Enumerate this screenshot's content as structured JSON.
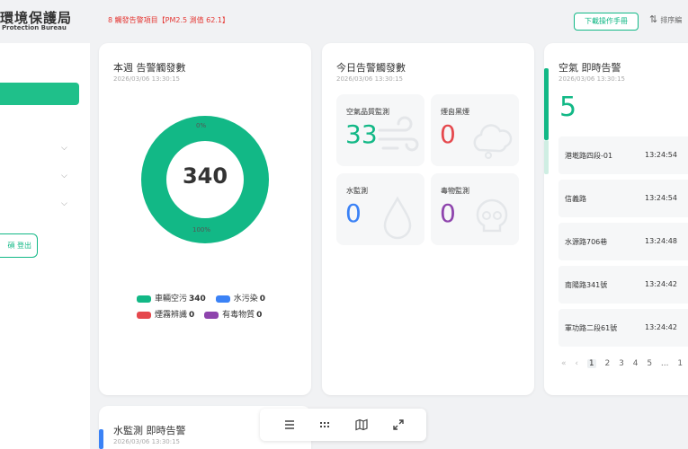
{
  "header": {
    "logo_cn": "環境保護局",
    "logo_en": "Protection Bureau",
    "alert": "8 觸發告警項目【PM2.5 測值 62.1】",
    "manual_button": "下載操作手冊",
    "sort_label": "排序編"
  },
  "sidebar": {
    "logout_label": "碩 登出"
  },
  "weekly": {
    "title": "本週 告警觸發數",
    "timestamp": "2026/03/06 13:30:15",
    "total": "340",
    "pct_top": "0%",
    "pct_bottom": "100%"
  },
  "chart_data": {
    "type": "pie",
    "categories": [
      "車輛空污",
      "水污染",
      "煙霧辨識",
      "有毒物質"
    ],
    "values": [
      340,
      0,
      0,
      0
    ],
    "colors": [
      "#12b886",
      "#3b82f6",
      "#e5484d",
      "#8e44ad"
    ]
  },
  "legend": [
    {
      "label": "車輛空污",
      "value": "340",
      "color": "#12b886"
    },
    {
      "label": "水污染",
      "value": "0",
      "color": "#3b82f6"
    },
    {
      "label": "煙霧辨識",
      "value": "0",
      "color": "#e5484d"
    },
    {
      "label": "有毒物質",
      "value": "0",
      "color": "#8e44ad"
    }
  ],
  "today": {
    "title": "今日告警觸發數",
    "timestamp": "2026/03/06 13:30:15",
    "tiles": [
      {
        "label": "空氣品質監測",
        "value": "33",
        "color": "#12b886",
        "icon": "wind-icon"
      },
      {
        "label": "煙囪黑煙",
        "value": "0",
        "color": "#e5484d",
        "icon": "smoke-cloud-icon"
      },
      {
        "label": "水監測",
        "value": "0",
        "color": "#3b82f6",
        "icon": "water-drop-icon"
      },
      {
        "label": "毒物監測",
        "value": "0",
        "color": "#8e44ad",
        "icon": "skull-icon"
      }
    ]
  },
  "realtime": {
    "title": "空氣 即時告警",
    "timestamp": "2026/03/06 13:30:15",
    "count": "5",
    "rows": [
      {
        "location": "港墘路四段-01",
        "time": "13:24:54"
      },
      {
        "location": "信義路",
        "time": "13:24:54"
      },
      {
        "location": "水源路706巷",
        "time": "13:24:48"
      },
      {
        "location": "南陽路341號",
        "time": "13:24:42"
      },
      {
        "location": "軍功路二段61號",
        "time": "13:24:42"
      }
    ],
    "pager": [
      "«",
      "‹",
      "1",
      "2",
      "3",
      "4",
      "5",
      "...",
      "1"
    ]
  },
  "water": {
    "title": "水監測 即時告警",
    "timestamp": "2026/03/06 13:30:15"
  },
  "toolbar": {
    "icons": [
      "list-icon",
      "grid-icon",
      "map-icon",
      "fullscreen-icon"
    ]
  }
}
